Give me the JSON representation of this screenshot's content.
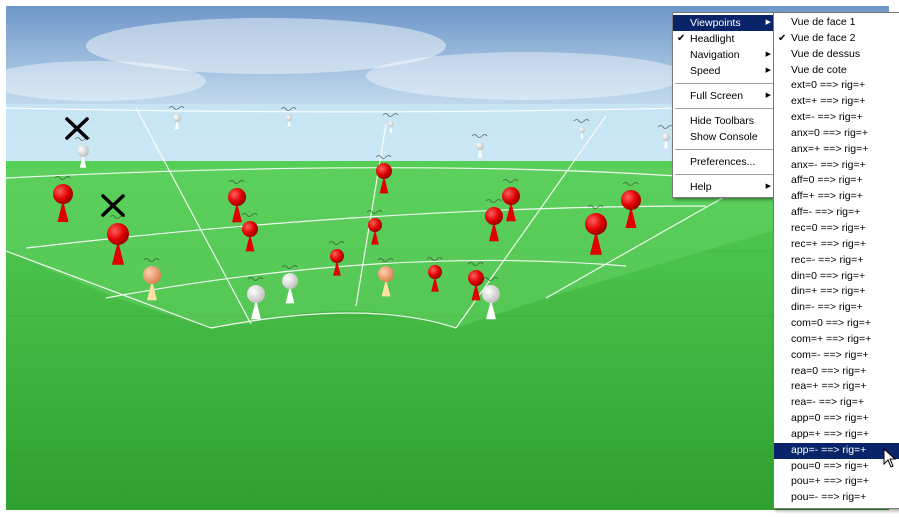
{
  "main_menu": {
    "items": [
      {
        "label": "Viewpoints",
        "submenu": true,
        "checked": false,
        "selected": true
      },
      {
        "label": "Headlight",
        "submenu": false,
        "checked": true,
        "selected": false
      },
      {
        "label": "Navigation",
        "submenu": true,
        "checked": false,
        "selected": false
      },
      {
        "label": "Speed",
        "submenu": true,
        "checked": false,
        "selected": false
      },
      {
        "label": "Full Screen",
        "submenu": true,
        "checked": false,
        "selected": false
      },
      {
        "label": "Hide Toolbars",
        "submenu": false,
        "checked": false,
        "selected": false
      },
      {
        "label": "Show Console",
        "submenu": false,
        "checked": false,
        "selected": false
      },
      {
        "label": "Preferences...",
        "submenu": false,
        "checked": false,
        "selected": false
      },
      {
        "label": "Help",
        "submenu": true,
        "checked": false,
        "selected": false
      }
    ],
    "arrow_glyph": "▶",
    "check_glyph": "✔"
  },
  "viewpoints_submenu": {
    "items": [
      {
        "label": "Vue de face 1",
        "checked": false,
        "selected": false
      },
      {
        "label": "Vue de face 2",
        "checked": true,
        "selected": false
      },
      {
        "label": "Vue de dessus",
        "checked": false,
        "selected": false
      },
      {
        "label": "Vue de cote",
        "checked": false,
        "selected": false
      },
      {
        "label": "ext=0 ==> rig=+",
        "checked": false,
        "selected": false
      },
      {
        "label": "ext=+ ==> rig=+",
        "checked": false,
        "selected": false
      },
      {
        "label": "ext=- ==> rig=+",
        "checked": false,
        "selected": false
      },
      {
        "label": "anx=0 ==> rig=+",
        "checked": false,
        "selected": false
      },
      {
        "label": "anx=+ ==> rig=+",
        "checked": false,
        "selected": false
      },
      {
        "label": "anx=- ==> rig=+",
        "checked": false,
        "selected": false
      },
      {
        "label": "aff=0 ==> rig=+",
        "checked": false,
        "selected": false
      },
      {
        "label": "aff=+ ==> rig=+",
        "checked": false,
        "selected": false
      },
      {
        "label": "aff=- ==> rig=+",
        "checked": false,
        "selected": false
      },
      {
        "label": "rec=0 ==> rig=+",
        "checked": false,
        "selected": false
      },
      {
        "label": "rec=+ ==> rig=+",
        "checked": false,
        "selected": false
      },
      {
        "label": "rec=- ==> rig=+",
        "checked": false,
        "selected": false
      },
      {
        "label": "din=0 ==> rig=+",
        "checked": false,
        "selected": false
      },
      {
        "label": "din=+ ==> rig=+",
        "checked": false,
        "selected": false
      },
      {
        "label": "din=- ==> rig=+",
        "checked": false,
        "selected": false
      },
      {
        "label": "com=0 ==> rig=+",
        "checked": false,
        "selected": false
      },
      {
        "label": "com=+ ==> rig=+",
        "checked": false,
        "selected": false
      },
      {
        "label": "com=- ==> rig=+",
        "checked": false,
        "selected": false
      },
      {
        "label": "rea=0 ==> rig=+",
        "checked": false,
        "selected": false
      },
      {
        "label": "rea=+ ==> rig=+",
        "checked": false,
        "selected": false
      },
      {
        "label": "rea=- ==> rig=+",
        "checked": false,
        "selected": false
      },
      {
        "label": "app=0 ==> rig=+",
        "checked": false,
        "selected": false
      },
      {
        "label": "app=+ ==> rig=+",
        "checked": false,
        "selected": false
      },
      {
        "label": "app=- ==> rig=+",
        "checked": false,
        "selected": true
      },
      {
        "label": "pou=0 ==> rig=+",
        "checked": false,
        "selected": false
      },
      {
        "label": "pou=+ ==> rig=+",
        "checked": false,
        "selected": false
      },
      {
        "label": "pou=- ==> rig=+",
        "checked": false,
        "selected": false
      }
    ]
  },
  "scene": {
    "colors": {
      "sky_top": "#5d8cc4",
      "sky_bottom": "#d7e8f5",
      "ground": "#3fbf3f",
      "ground_dark": "#2e9e2e",
      "marker_red": "#e00000",
      "marker_white": "#f4f4f4",
      "marker_orange": "#f0a070",
      "grid_line": "#ffffff"
    }
  },
  "colors": {
    "menu_bg": "#ffffff",
    "menu_highlight": "#0a246a",
    "menu_highlight_text": "#ffffff"
  }
}
